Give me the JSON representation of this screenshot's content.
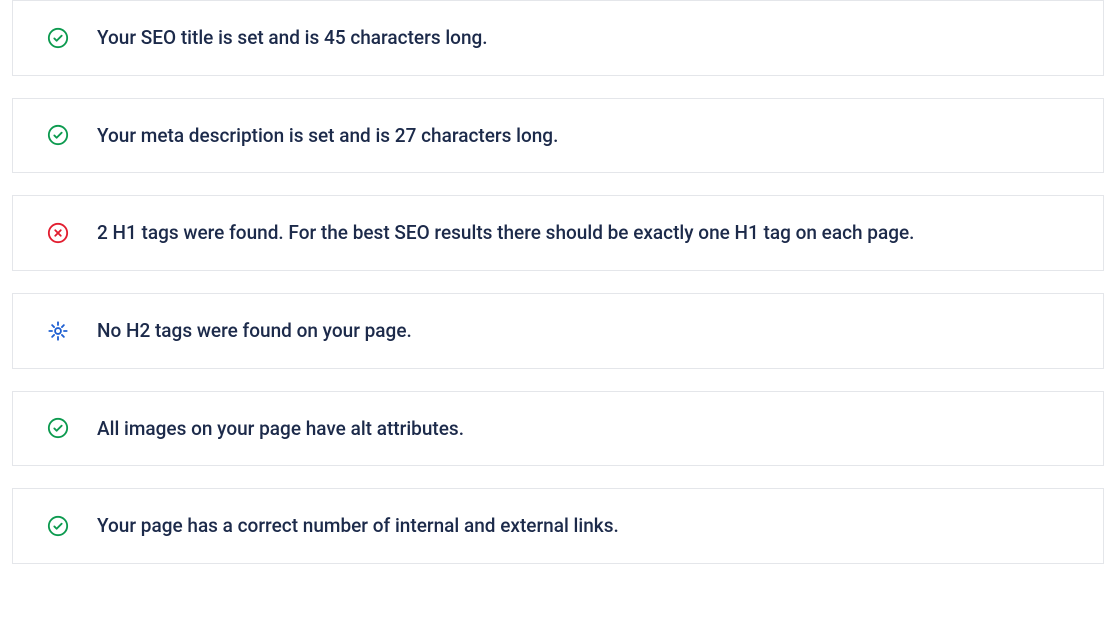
{
  "colors": {
    "success": "#0c9a4f",
    "error": "#e21e30",
    "info": "#1f60d2",
    "text": "#1c2a4a",
    "border": "#e4e6ea"
  },
  "icons": {
    "success": "check-circle-icon",
    "error": "x-circle-icon",
    "info": "gear-icon"
  },
  "checks": [
    {
      "status": "success",
      "message": "Your SEO title is set and is 45 characters long."
    },
    {
      "status": "success",
      "message": "Your meta description is set and is 27 characters long."
    },
    {
      "status": "error",
      "message": "2 H1 tags were found. For the best SEO results there should be exactly one H1 tag on each page."
    },
    {
      "status": "info",
      "message": "No H2 tags were found on your page."
    },
    {
      "status": "success",
      "message": "All images on your page have alt attributes."
    },
    {
      "status": "success",
      "message": "Your page has a correct number of internal and external links."
    }
  ]
}
